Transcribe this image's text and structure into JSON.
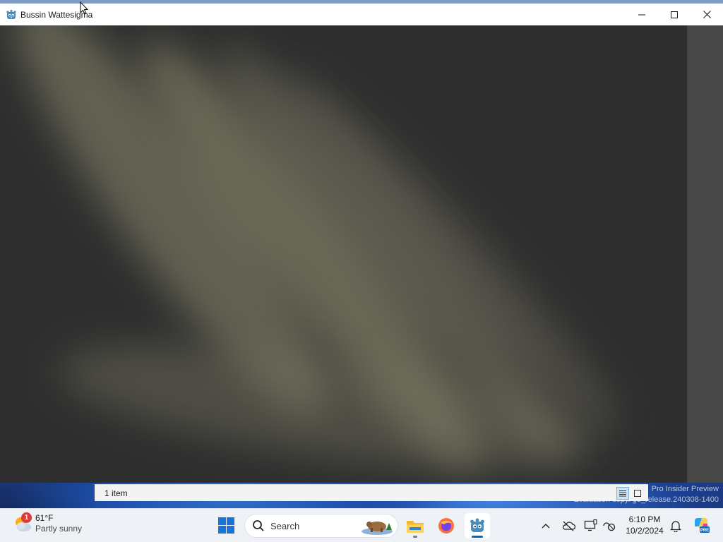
{
  "window": {
    "title": "Bussin Wattesigma",
    "icon": "godot-icon",
    "controls": [
      "minimize-icon",
      "maximize-icon",
      "close-icon"
    ]
  },
  "explorer": {
    "status_text": "1 item",
    "view_buttons": [
      "details-view-icon",
      "large-icons-view-icon"
    ]
  },
  "desktop": {
    "watermark_line1": "Pro Insider Preview",
    "watermark_line2": "Evaluation copy. ge_release.240308-1400"
  },
  "taskbar": {
    "weather": {
      "badge": "1",
      "temp": "61°F",
      "condition": "Partly sunny"
    },
    "search_label": "Search",
    "apps": [
      "file-explorer-icon",
      "firefox-icon",
      "godot-icon"
    ],
    "tray": [
      "chevron-up-icon",
      "onedrive-icon",
      "display-icon",
      "focus-icon"
    ],
    "clock": {
      "time": "6:10 PM",
      "date": "10/2/2024"
    },
    "notification_icon": "bell-icon",
    "copilot_badge": "PRE"
  },
  "colors": {
    "canvas_bg": "#2e2e2e",
    "beam": "#8e8c6e",
    "taskbar_bg": "#eef1f6",
    "accent": "#0067c0"
  }
}
